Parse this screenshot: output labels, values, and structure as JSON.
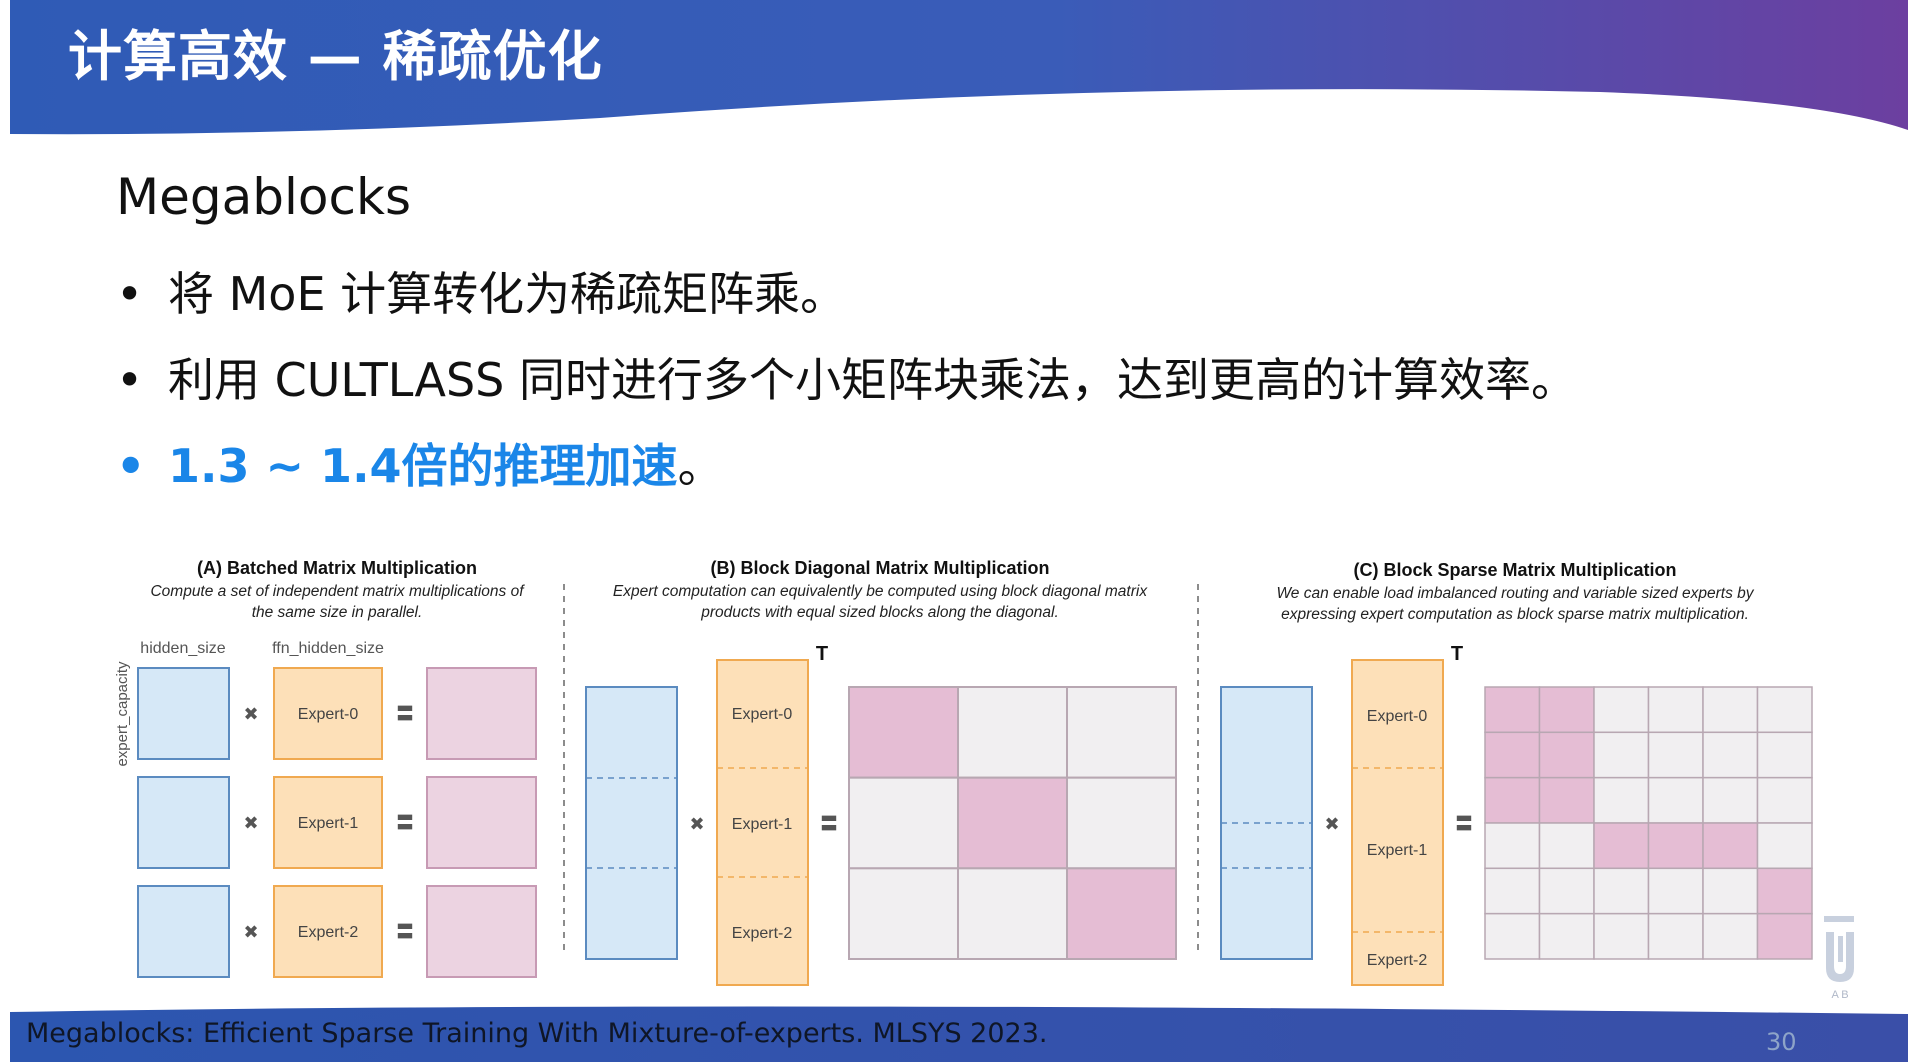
{
  "slide": {
    "title": "计算高效 — 稀疏优化",
    "subtitle": "Megablocks",
    "bullets": [
      {
        "marker": "•",
        "text": "将 MoE 计算转化为稀疏矩阵乘。"
      },
      {
        "marker": "•",
        "text": "利用 CULTLASS 同时进行多个小矩阵块乘法，达到更高的计算效率。"
      },
      {
        "marker": "•",
        "highlight": "1.3 ~ 1.4倍的推理加速",
        "tail": "。"
      }
    ],
    "footer": "Megablocks: Efficient Sparse Training With Mixture-of-experts. MLSYS 2023.",
    "page_number": "30",
    "logo_text": "A B"
  },
  "colors": {
    "header_blue": "#2f5bb6",
    "header_purple": "#6c3fa0",
    "highlight": "#1a86e8",
    "token_fill": "#d6e8f7",
    "token_stroke": "#5b8bc0",
    "expert_fill": "#fde0b8",
    "expert_stroke": "#f0a950",
    "output_fill": "#ecd3e1",
    "output_stroke": "#c79ab4",
    "block_fill": "#e5bdd4",
    "empty_fill": "#f1eff1",
    "grid_stroke": "#b8a7b2"
  },
  "diagram": {
    "panel_a": {
      "title": "(A) Batched Matrix Multiplication",
      "desc1": "Compute a set of independent matrix multiplications of",
      "desc2": "the same size in parallel.",
      "label_hidden": "hidden_size",
      "label_ffn": "ffn_hidden_size",
      "label_capacity": "expert_capacity",
      "experts": [
        "Expert-0",
        "Expert-1",
        "Expert-2"
      ],
      "times_symbol": "✖",
      "equals_symbol": "〓"
    },
    "panel_b": {
      "title": "(B) Block Diagonal Matrix Multiplication",
      "desc1": "Expert computation can equivalently be computed using block diagonal matrix",
      "desc2": "products with equal sized blocks along the diagonal.",
      "transpose": "T",
      "experts": [
        "Expert-0",
        "Expert-1",
        "Expert-2"
      ],
      "grid_rows": 3,
      "grid_cols": 3,
      "filled_cells": [
        [
          0,
          0
        ],
        [
          1,
          1
        ],
        [
          2,
          2
        ]
      ]
    },
    "panel_c": {
      "title": "(C) Block Sparse Matrix Multiplication",
      "desc1": "We can enable load imbalanced routing and variable sized experts by",
      "desc2": "expressing expert computation as block sparse matrix multiplication.",
      "transpose": "T",
      "experts": [
        "Expert-0",
        "Expert-1",
        "Expert-2"
      ],
      "grid_rows": 6,
      "grid_cols": 6,
      "filled_cells": [
        [
          0,
          0
        ],
        [
          0,
          1
        ],
        [
          1,
          0
        ],
        [
          1,
          1
        ],
        [
          2,
          0
        ],
        [
          2,
          1
        ],
        [
          3,
          2
        ],
        [
          3,
          3
        ],
        [
          3,
          4
        ],
        [
          4,
          5
        ],
        [
          5,
          5
        ]
      ]
    }
  }
}
